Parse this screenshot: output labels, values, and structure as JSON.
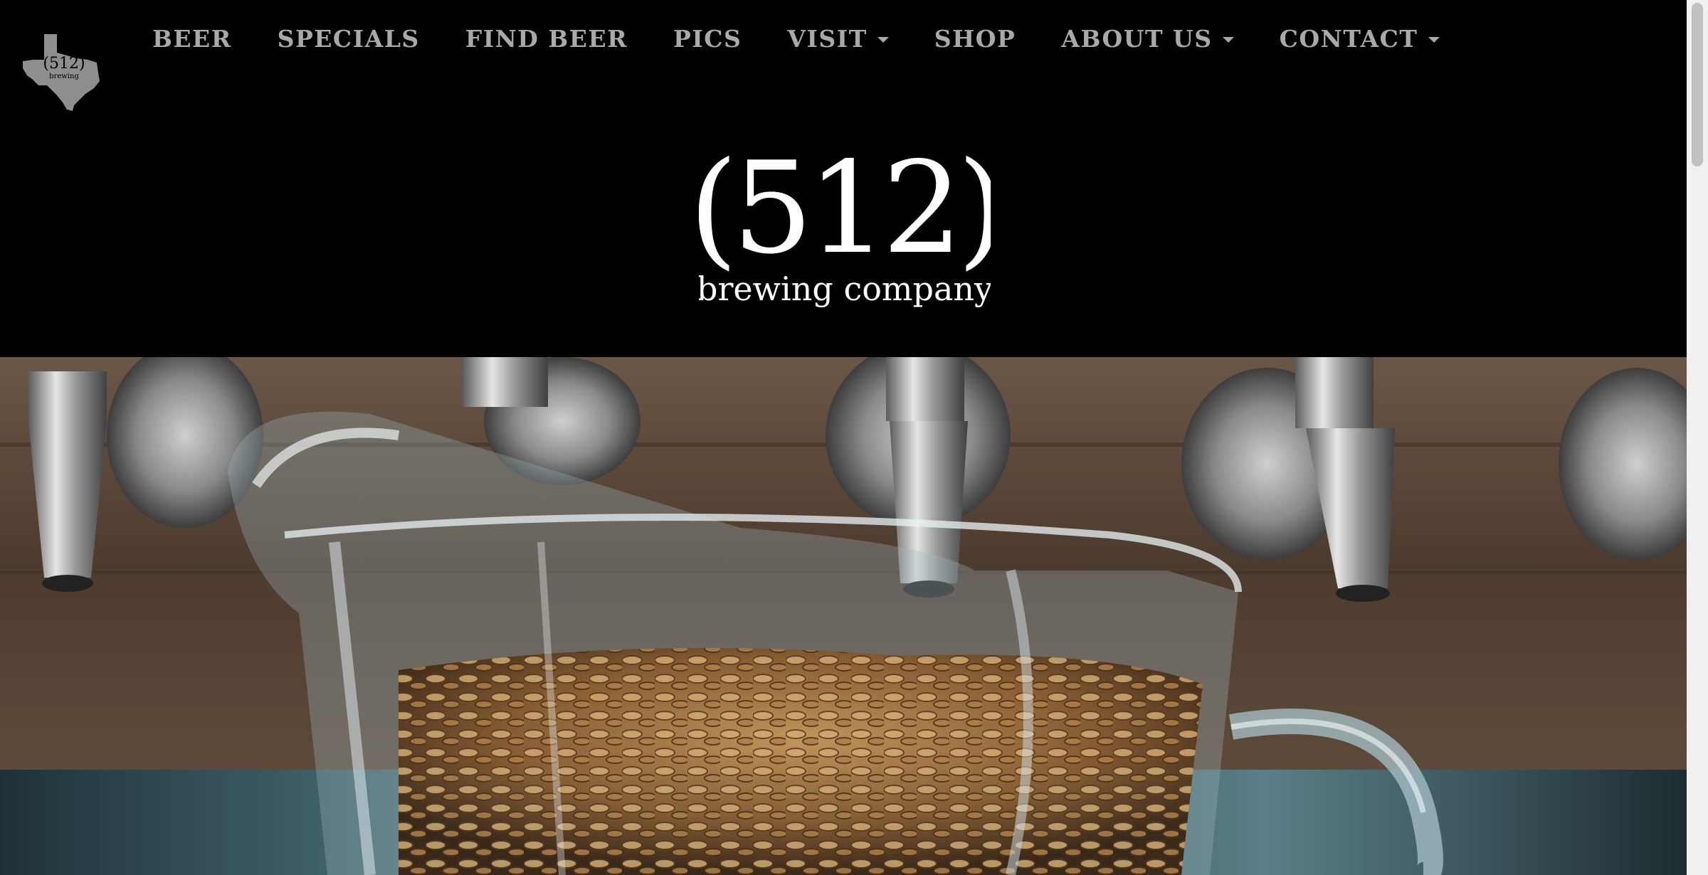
{
  "nav": {
    "items": [
      {
        "label": "BEER",
        "dropdown": false
      },
      {
        "label": "SPECIALS",
        "dropdown": false
      },
      {
        "label": "FIND BEER",
        "dropdown": false
      },
      {
        "label": "PICS",
        "dropdown": false
      },
      {
        "label": "VISIT",
        "dropdown": true
      },
      {
        "label": "SHOP",
        "dropdown": false
      },
      {
        "label": "ABOUT US",
        "dropdown": true
      },
      {
        "label": "CONTACT",
        "dropdown": true
      }
    ]
  },
  "brand": {
    "corner_logo_text": "(512)",
    "corner_logo_subtext": "brewing",
    "main_logo_number": "(512)",
    "main_logo_tagline": "brewing company"
  },
  "hero": {
    "subject": "glass pitcher of malted barley in front of beer taps"
  },
  "colors": {
    "background": "#000000",
    "nav_text": "#a9a9a9",
    "logo": "#ffffff"
  }
}
